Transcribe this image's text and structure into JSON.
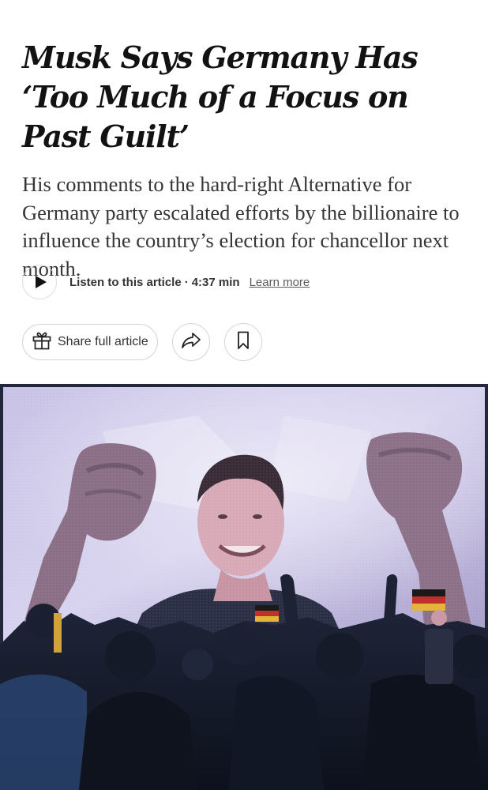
{
  "article": {
    "headline": "Musk Says Germany Has ‘Too Much of a Focus on Past Guilt’",
    "summary": "His comments to the hard-right Alternative for Germany party escalated efforts by the billionaire to influence the country’s election for chancellor next month."
  },
  "audio": {
    "listen_label": "Listen to this article",
    "separator": "·",
    "duration": "4:37 min",
    "learn_more": "Learn more",
    "play_icon": "play-icon"
  },
  "actions": {
    "share_label": "Share full article",
    "share_icon": "gift-icon",
    "forward_icon": "share-arrow-icon",
    "save_icon": "bookmark-icon"
  },
  "colors": {
    "text": "#121212",
    "summary_text": "#363636",
    "border": "#d5d5d5",
    "photo_screen": "#b7b0d8",
    "photo_crowd": "#141b2c"
  }
}
